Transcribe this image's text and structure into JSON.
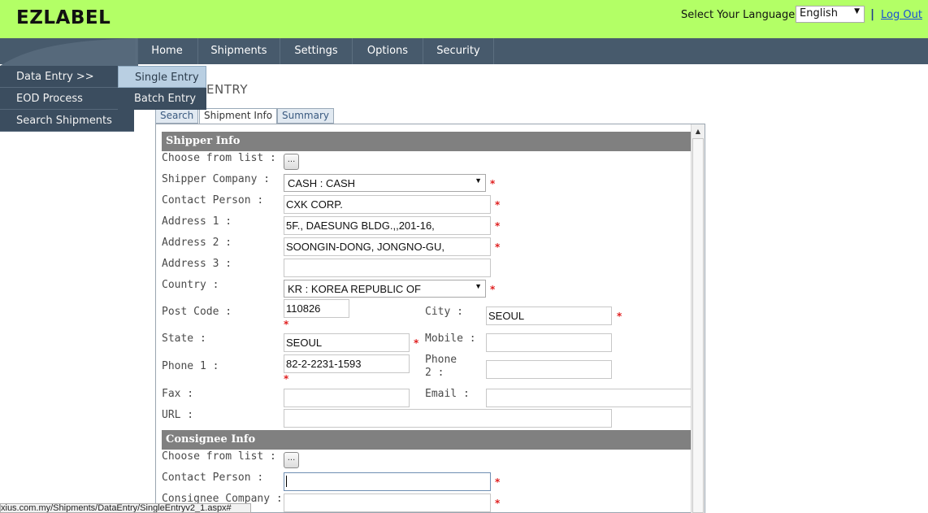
{
  "header": {
    "logo": "EZLABEL",
    "language_label": "Select Your Language:",
    "language_value": "English",
    "separator": "|",
    "logout": "Log Out"
  },
  "nav": {
    "items": [
      "Home",
      "Shipments",
      "Settings",
      "Options",
      "Security"
    ]
  },
  "menu": {
    "items": [
      "Data Entry >>",
      "EOD Process",
      "Search Shipments"
    ],
    "submenu": [
      "Single Entry",
      "Batch Entry"
    ]
  },
  "page": {
    "title_partial": "ENTRY"
  },
  "tabs": [
    "Search",
    "Shipment Info",
    "Summary"
  ],
  "shipper": {
    "section_title": "Shipper Info",
    "labels": {
      "choose": "Choose from list :",
      "company": "Shipper Company :",
      "contact": "Contact Person :",
      "address1": "Address 1 :",
      "address2": "Address 2 :",
      "address3": "Address 3 :",
      "country": "Country :",
      "postcode": "Post Code :",
      "city": "City :",
      "state": "State :",
      "mobile": "Mobile :",
      "phone1": "Phone 1 :",
      "phone2_a": "Phone",
      "phone2_b": "2 :",
      "fax": "Fax :",
      "email": "Email :",
      "url": "URL :"
    },
    "values": {
      "company": "CASH : CASH",
      "contact": "CXK CORP.",
      "address1": "5F., DAESUNG BLDG.,,201-16,",
      "address2": "SOONGIN-DONG, JONGNO-GU,",
      "address3": "",
      "country": "KR : KOREA REPUBLIC OF",
      "postcode": "110826",
      "city": "SEOUL",
      "state": "SEOUL",
      "mobile": "",
      "phone1": "82-2-2231-1593",
      "phone2": "",
      "fax": "",
      "email": "",
      "url": ""
    }
  },
  "consignee": {
    "section_title": "Consignee Info",
    "labels": {
      "choose": "Choose from list :",
      "contact": "Contact Person :",
      "company": "Consignee Company :"
    },
    "values": {
      "contact": "",
      "company": ""
    }
  },
  "pick_button": "...",
  "required_mark": "*",
  "status_bar": "xius.com.my/Shipments/DataEntry/SingleEntryv2_1.aspx#"
}
